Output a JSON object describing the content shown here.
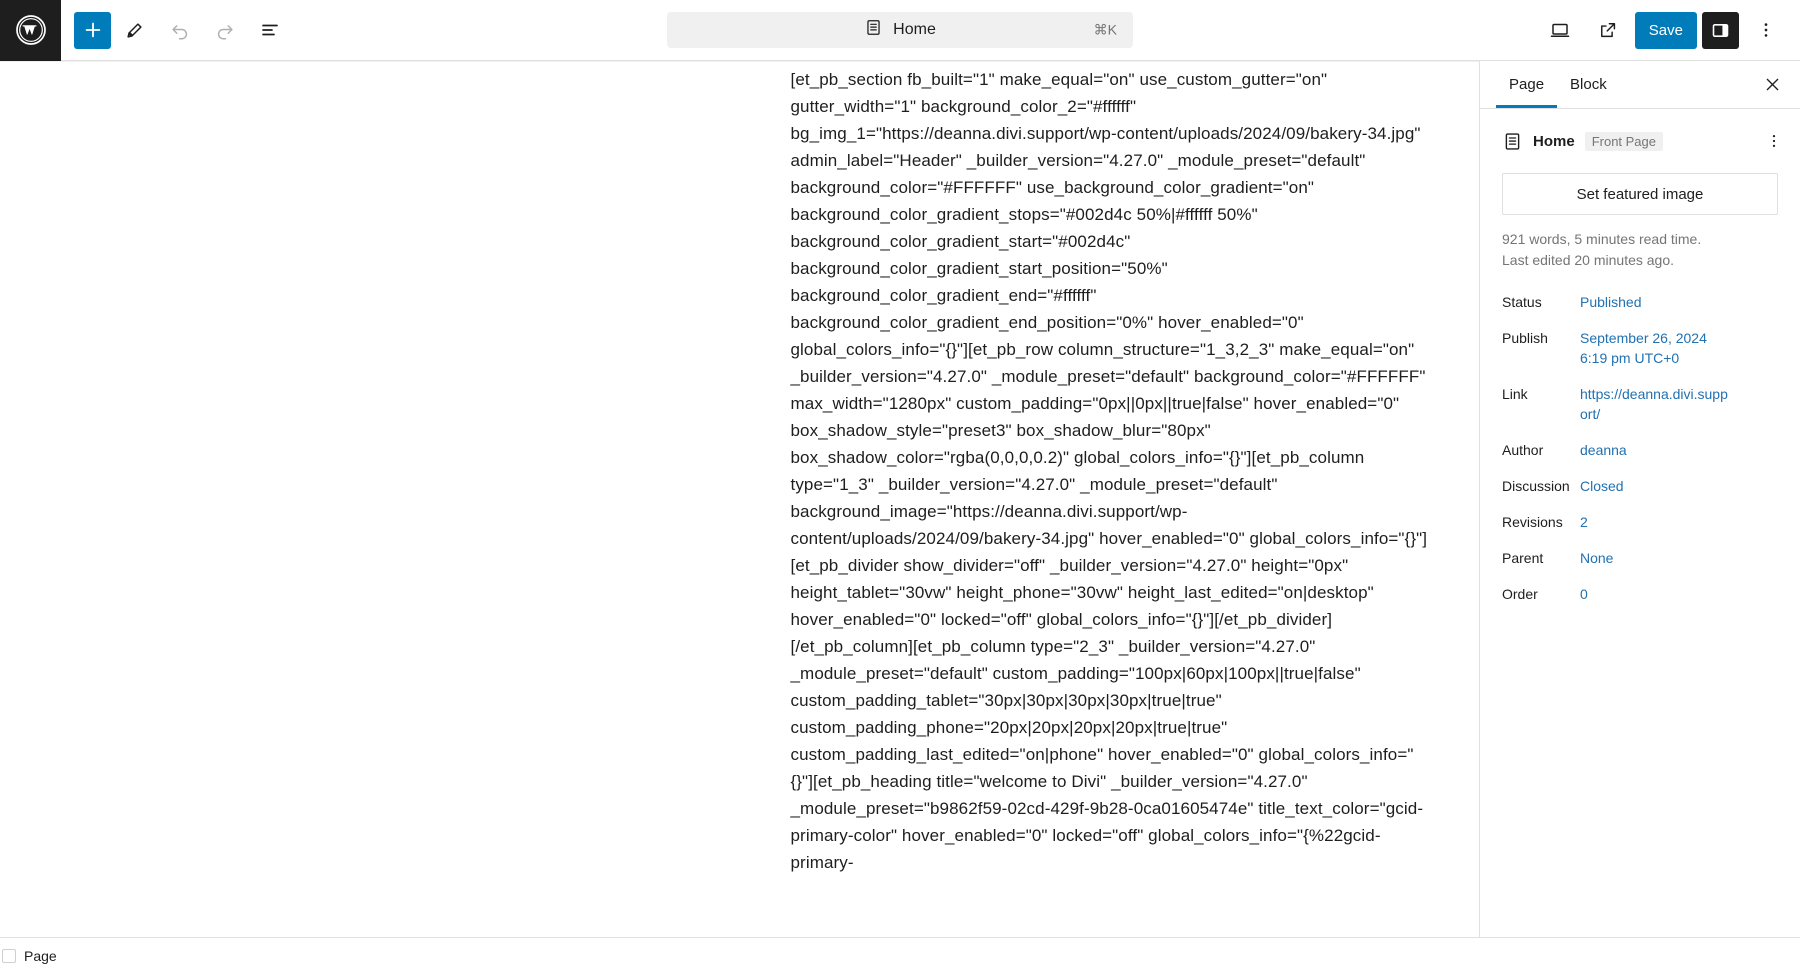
{
  "header": {
    "logo_icon": "wordpress-logo-icon",
    "add_block_icon": "plus-icon",
    "edit_tool_icon": "pencil-icon",
    "undo_icon": "undo-arrow-icon",
    "redo_icon": "redo-arrow-icon",
    "list_view_icon": "document-outline-icon",
    "document_title": "Home",
    "document_icon": "page-icon",
    "command_shortcut": "⌘K",
    "preview_icon": "desktop-view-icon",
    "view_site_icon": "external-link-icon",
    "save_label": "Save",
    "sidebar_toggle_icon": "sidebar-panel-icon",
    "options_icon": "kebab-menu-icon",
    "accent_color": "#007cba"
  },
  "content": {
    "block_text": "[et_pb_section fb_built=\"1\" make_equal=\"on\" use_custom_gutter=\"on\" gutter_width=\"1\" background_color_2=\"#ffffff\" bg_img_1=\"https://deanna.divi.support/wp-content/uploads/2024/09/bakery-34.jpg\" admin_label=\"Header\" _builder_version=\"4.27.0\" _module_preset=\"default\" background_color=\"#FFFFFF\" use_background_color_gradient=\"on\" background_color_gradient_stops=\"#002d4c 50%|#ffffff 50%\" background_color_gradient_start=\"#002d4c\" background_color_gradient_start_position=\"50%\" background_color_gradient_end=\"#ffffff\" background_color_gradient_end_position=\"0%\" hover_enabled=\"0\" global_colors_info=\"{}\"][et_pb_row column_structure=\"1_3,2_3\" make_equal=\"on\" _builder_version=\"4.27.0\" _module_preset=\"default\" background_color=\"#FFFFFF\" max_width=\"1280px\" custom_padding=\"0px||0px||true|false\" hover_enabled=\"0\" box_shadow_style=\"preset3\" box_shadow_blur=\"80px\" box_shadow_color=\"rgba(0,0,0,0.2)\" global_colors_info=\"{}\"][et_pb_column type=\"1_3\" _builder_version=\"4.27.0\" _module_preset=\"default\" background_image=\"https://deanna.divi.support/wp-content/uploads/2024/09/bakery-34.jpg\" hover_enabled=\"0\" global_colors_info=\"{}\"][et_pb_divider show_divider=\"off\" _builder_version=\"4.27.0\" height=\"0px\" height_tablet=\"30vw\" height_phone=\"30vw\" height_last_edited=\"on|desktop\" hover_enabled=\"0\" locked=\"off\" global_colors_info=\"{}\"][/et_pb_divider][/et_pb_column][et_pb_column type=\"2_3\" _builder_version=\"4.27.0\" _module_preset=\"default\" custom_padding=\"100px|60px|100px||true|false\" custom_padding_tablet=\"30px|30px|30px|30px|true|true\" custom_padding_phone=\"20px|20px|20px|20px|true|true\" custom_padding_last_edited=\"on|phone\" hover_enabled=\"0\" global_colors_info=\"{}\"][et_pb_heading title=\"welcome to Divi\" _builder_version=\"4.27.0\" _module_preset=\"b9862f59-02cd-429f-9b28-0ca01605474e\" title_text_color=\"gcid-primary-color\" hover_enabled=\"0\" locked=\"off\" global_colors_info=\"{%22gcid-primary-"
  },
  "sidebar": {
    "tabs": [
      {
        "label": "Page",
        "active": true
      },
      {
        "label": "Block",
        "active": false
      }
    ],
    "close_icon": "close-x-icon",
    "page_icon": "page-document-icon",
    "page_name": "Home",
    "page_badge": "Front Page",
    "page_kebab_icon": "kebab-menu-icon",
    "featured_image_label": "Set featured image",
    "stats": [
      "921 words, 5 minutes read time.",
      "Last edited 20 minutes ago."
    ],
    "meta": [
      {
        "label": "Status",
        "value": "Published"
      },
      {
        "label": "Publish",
        "value": "September 26, 2024 6:19 pm UTC+0"
      },
      {
        "label": "Link",
        "value": "https://deanna.divi.support/"
      },
      {
        "label": "Author",
        "value": "deanna"
      },
      {
        "label": "Discussion",
        "value": "Closed"
      },
      {
        "label": "Revisions",
        "value": "2"
      },
      {
        "label": "Parent",
        "value": "None"
      },
      {
        "label": "Order",
        "value": "0"
      }
    ],
    "link_color": "#2271b1"
  },
  "footer": {
    "breadcrumb_label": "Page"
  }
}
